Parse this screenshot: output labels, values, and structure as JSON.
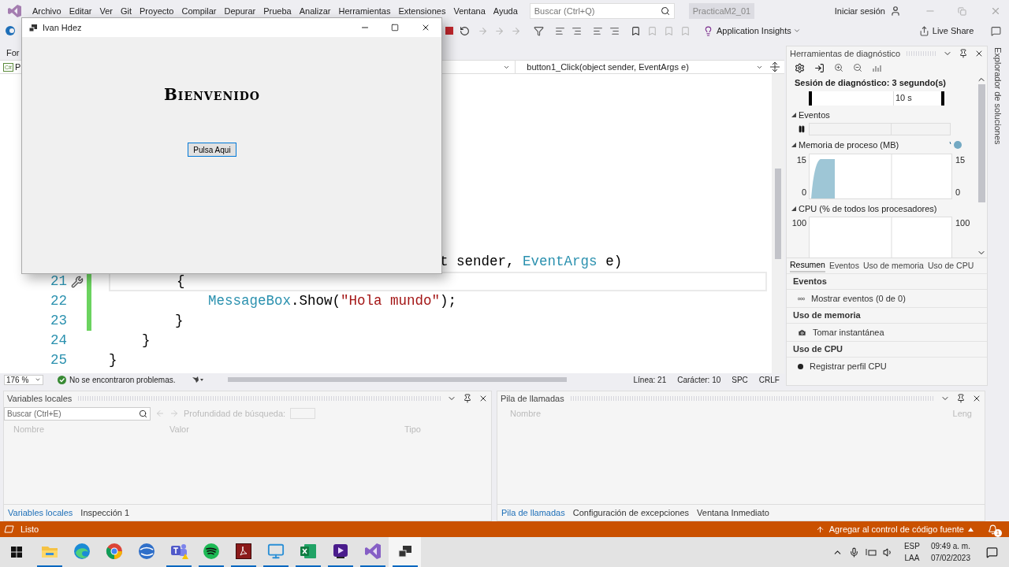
{
  "menu_bar": {
    "menus": [
      "Archivo",
      "Editar",
      "Ver",
      "Git",
      "Proyecto",
      "Compilar",
      "Depurar",
      "Prueba",
      "Analizar",
      "Herramientas",
      "Extensiones",
      "Ventana",
      "Ayuda"
    ],
    "search": {
      "placeholder": "Buscar (Ctrl+Q)"
    },
    "solution_name": "PracticaM2_01",
    "sign_in": "Iniciar sesión"
  },
  "toolbar": {
    "application_insights": "Application Insights",
    "live_share": "Live Share"
  },
  "editor": {
    "tab": "For",
    "project_icon": "C#",
    "project_prefix": "P",
    "member_dropdown": "button1_Click(object sender, EventArgs e)",
    "lines": [
      {
        "current": false,
        "changed": false,
        "segments": [
          {
            "kind": "plain",
            "text": "                                        t sender, "
          },
          {
            "kind": "type",
            "text": "EventArgs"
          },
          {
            "kind": "plain",
            "text": " e)"
          }
        ]
      },
      {
        "number": "21",
        "current": true,
        "changed": true,
        "segments": [
          {
            "kind": "plain",
            "text": "        {"
          }
        ]
      },
      {
        "number": "22",
        "current": false,
        "changed": true,
        "segments": [
          {
            "kind": "type",
            "text": "            MessageBox"
          },
          {
            "kind": "plain",
            "text": ".Show("
          },
          {
            "kind": "string",
            "text": "\"Hola mundo\""
          },
          {
            "kind": "plain",
            "text": ");"
          }
        ]
      },
      {
        "number": "23",
        "current": false,
        "changed": true,
        "segments": [
          {
            "kind": "plain",
            "text": "        }"
          }
        ]
      },
      {
        "number": "24",
        "current": false,
        "changed": false,
        "segments": [
          {
            "kind": "plain",
            "text": "    }"
          }
        ]
      },
      {
        "number": "25",
        "current": false,
        "changed": false,
        "segments": [
          {
            "kind": "plain",
            "text": "}"
          }
        ]
      }
    ],
    "status": {
      "zoom": "176 %",
      "problems": "No se encontraron problemas.",
      "line": "Línea: 21",
      "column": "Carácter: 10",
      "spacing": "SPC",
      "line_ending": "CRLF"
    }
  },
  "diagnostics": {
    "title": "Herramientas de diagnóstico",
    "session": "Sesión de diagnóstico: 3 segundo(s)",
    "ruler_label": "10 s",
    "sections": [
      {
        "kind": "events",
        "title": "Eventos"
      },
      {
        "kind": "memory",
        "title": "Memoria de proceso (MB)",
        "left_max": "15",
        "left_min": "0",
        "right_max": "15",
        "right_min": "0"
      },
      {
        "kind": "cpu",
        "title": "CPU (% de todos los procesadores)",
        "left_max": "100",
        "right_max": "100"
      }
    ],
    "tabs": [
      {
        "label": "Resumen",
        "selected": true
      },
      {
        "label": "Eventos",
        "selected": false
      },
      {
        "label": "Uso de memoria",
        "selected": false
      },
      {
        "label": "Uso de CPU",
        "selected": false
      }
    ],
    "summary": [
      {
        "kind": "events",
        "heading": "Eventos",
        "action": "Mostrar eventos (0 de 0)"
      },
      {
        "kind": "memory",
        "heading": "Uso de memoria",
        "action": "Tomar instantánea"
      },
      {
        "kind": "cpu",
        "heading": "Uso de CPU",
        "action": "Registrar perfil CPU"
      }
    ]
  },
  "side_strip": "Explorador de soluciones",
  "locals": {
    "title": "Variables locales",
    "search": {
      "placeholder": "Buscar (Ctrl+E)"
    },
    "depth_label": "Profundidad de búsqueda:",
    "columns": [
      "Nombre",
      "Valor",
      "Tipo"
    ],
    "tabs": [
      {
        "label": "Variables locales",
        "selected": true
      },
      {
        "label": "Inspección 1",
        "selected": false
      }
    ]
  },
  "call_stack": {
    "title": "Pila de llamadas",
    "columns": [
      "Nombre",
      "Leng"
    ],
    "tabs": [
      {
        "label": "Pila de llamadas",
        "selected": true
      },
      {
        "label": "Configuración de excepciones",
        "selected": false
      },
      {
        "label": "Ventana Inmediato",
        "selected": false
      }
    ]
  },
  "status_bar": {
    "text": "Listo",
    "source_control": "Agregar al control de código fuente",
    "notifications": "1"
  },
  "taskbar": {
    "apps": [
      {
        "kind": "explorer",
        "running": true,
        "active": false
      },
      {
        "kind": "edge",
        "running": false,
        "active": false
      },
      {
        "kind": "chrome",
        "running": false,
        "active": false
      },
      {
        "kind": "globe",
        "running": false,
        "active": false
      },
      {
        "kind": "teams",
        "running": true,
        "active": false
      },
      {
        "kind": "spotify",
        "running": true,
        "active": false
      },
      {
        "kind": "pdf",
        "running": true,
        "active": false
      },
      {
        "kind": "remote",
        "running": true,
        "active": false
      },
      {
        "kind": "excel",
        "running": true,
        "active": false
      },
      {
        "kind": "media",
        "running": true,
        "active": false
      },
      {
        "kind": "vs",
        "running": true,
        "active": false
      },
      {
        "kind": "form",
        "running": true,
        "active": true
      }
    ],
    "language": "ESP",
    "layout": "LAA",
    "time": "09:49 a. m.",
    "date": "07/02/2023"
  },
  "dialog": {
    "title": "Ivan Hdez",
    "heading": "Bienvenido",
    "button": "Pulsa Aqui"
  }
}
